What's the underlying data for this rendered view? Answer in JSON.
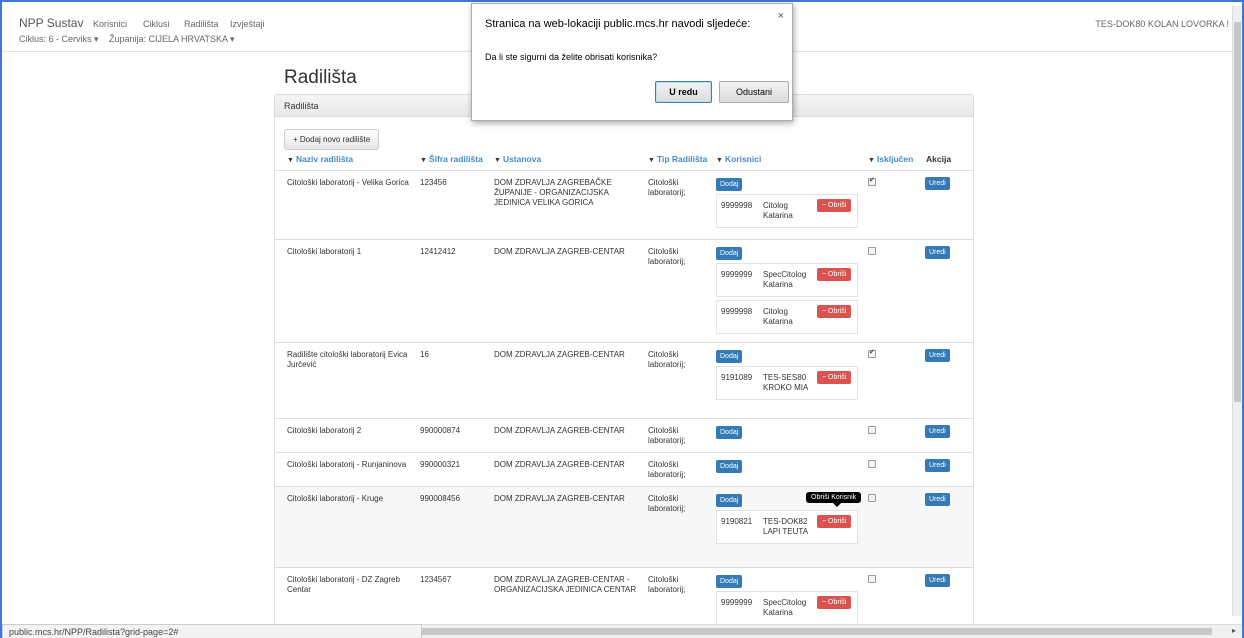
{
  "navbar": {
    "brand": "NPP Sustav",
    "links": [
      "Korisnici",
      "Ciklusi",
      "Radilišta",
      "Izvještaji"
    ],
    "ciklus": "Ciklus: 6 - Cerviks ▾",
    "zupanija": "Županija: CIJELA HRVATSKA ▾",
    "user": "TES-DOK80 KOLAN LOVORKA ! ▾"
  },
  "page": {
    "title": "Radilišta",
    "panel_heading": "Radilišta",
    "add_button": "+ Dodaj novo radilište"
  },
  "columns": {
    "naziv": "Naziv radilišta",
    "sifra": "Šifra radilišta",
    "ustanova": "Ustanova",
    "tip": "Tip Radilišta",
    "korisnici": "Korisnici",
    "iskljucen": "Isključen",
    "akcija": "Akcija"
  },
  "labels": {
    "dodaj": "Dodaj",
    "obrisi": "− Obriši",
    "uredi": "Uredi"
  },
  "rows": [
    {
      "naziv": "Citološki laboratorij - Velika Gorica",
      "sifra": "123456",
      "ustanova": "DOM ZDRAVLJA ZAGREBAČKE ŽUPANIJE - ORGANIZACIJSKA JEDINICA VELIKA GORICA",
      "tip": "Citološki laboratorij;",
      "iskljucen": true,
      "users": [
        {
          "id": "9999998",
          "name": "Citolog Katarina"
        }
      ]
    },
    {
      "naziv": "Citološki laboratorij 1",
      "sifra": "12412412",
      "ustanova": "DOM ZDRAVLJA ZAGREB-CENTAR",
      "tip": "Citološki laboratorij;",
      "iskljucen": false,
      "users": [
        {
          "id": "9999999",
          "name": "SpecCitolog Katarina"
        },
        {
          "id": "9999998",
          "name": "Citolog Katarina"
        }
      ]
    },
    {
      "naziv": "Radilište citološki laboratorij Evica Jurčević",
      "sifra": "16",
      "ustanova": "DOM ZDRAVLJA ZAGREB-CENTAR",
      "tip": "Citološki laboratorij;",
      "iskljucen": true,
      "users": [
        {
          "id": "9191089",
          "name": "TES-SES80 KROKO MIA"
        }
      ]
    },
    {
      "naziv": "Citološki laboratorij 2",
      "sifra": "990000874",
      "ustanova": "DOM ZDRAVLJA ZAGREB-CENTAR",
      "tip": "Citološki laboratorij;",
      "iskljucen": false,
      "users": []
    },
    {
      "naziv": "Citološki laboratorij - Runjaninova",
      "sifra": "990000321",
      "ustanova": "DOM ZDRAVLJA ZAGREB-CENTAR",
      "tip": "Citološki laboratorij;",
      "iskljucen": false,
      "users": []
    },
    {
      "naziv": "Citološki laboratorij - Kruge",
      "sifra": "990008456",
      "ustanova": "DOM ZDRAVLJA ZAGREB-CENTAR",
      "tip": "Citološki laboratorij;",
      "iskljucen": false,
      "users": [
        {
          "id": "9190821",
          "name": "TES-DOK82 LAPI TEUTA"
        }
      ]
    },
    {
      "naziv": "Citološki laboratorij - DZ Zagreb Centar",
      "sifra": "1234567",
      "ustanova": "DOM ZDRAVLJA ZAGREB-CENTAR - ORGANIZACIJSKA JEDINICA CENTAR",
      "tip": "Citološki laboratorij;",
      "iskljucen": false,
      "users": [
        {
          "id": "9999999",
          "name": "SpecCitolog Katarina"
        }
      ]
    }
  ],
  "tooltip": "Obriši Korisnik",
  "dialog": {
    "title": "Stranica na web-lokaciji public.mcs.hr navodi sljedeće:",
    "message": "Da li ste sigurni da želite obrisati korisnika?",
    "ok": "U redu",
    "cancel": "Odustani",
    "close": "×"
  },
  "statusbar": "public.mcs.hr/NPP/Radilista?grid-page=2#"
}
